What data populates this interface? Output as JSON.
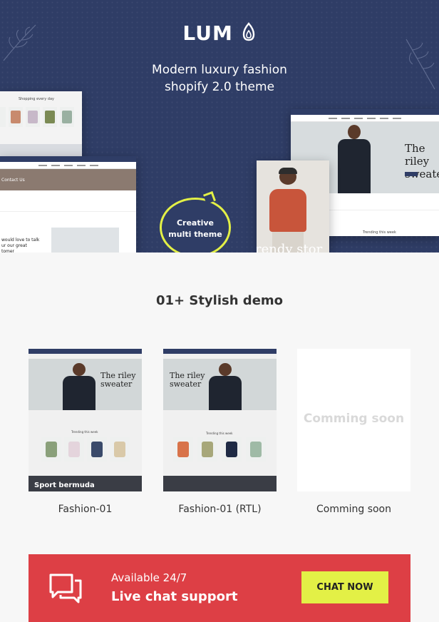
{
  "hero": {
    "logo_text": "LUM",
    "tagline_line1": "Modern luxury fashion",
    "tagline_line2": "shopify 2.0 theme",
    "bubble_line1": "Creative",
    "bubble_line2": "multi theme",
    "mock_left_top": "Shopping every day",
    "mock_left_contact": "Contact Us",
    "mock_left_talk": "would love to talk",
    "mock_left_talk2": "ur our great",
    "mock_left_talk3": "tomer",
    "mock_right_heading": "The riley",
    "mock_right_heading2": "sweate",
    "mock_right_trending": "Trending this week",
    "mock_model_text": "rendy stor",
    "colors": {
      "navy": "#2f3d66",
      "accent": "#e3f046"
    }
  },
  "section": {
    "title": "01+ Stylish demo"
  },
  "demos": [
    {
      "label": "Fashion-01",
      "heading1": "The riley",
      "heading2": "sweater",
      "trending": "Trending this week",
      "bottom": "Sport bermuda"
    },
    {
      "label": "Fashion-01 (RTL)",
      "heading1": "The riley",
      "heading2": "sweater",
      "trending": "Trending this week"
    },
    {
      "label": "Comming soon",
      "placeholder": "Comming soon"
    }
  ],
  "banner": {
    "available": "Available 24/7",
    "live": "Live chat support",
    "button": "CHAT NOW",
    "icon": "chat-bubbles-icon",
    "color": "#dd3f45"
  }
}
